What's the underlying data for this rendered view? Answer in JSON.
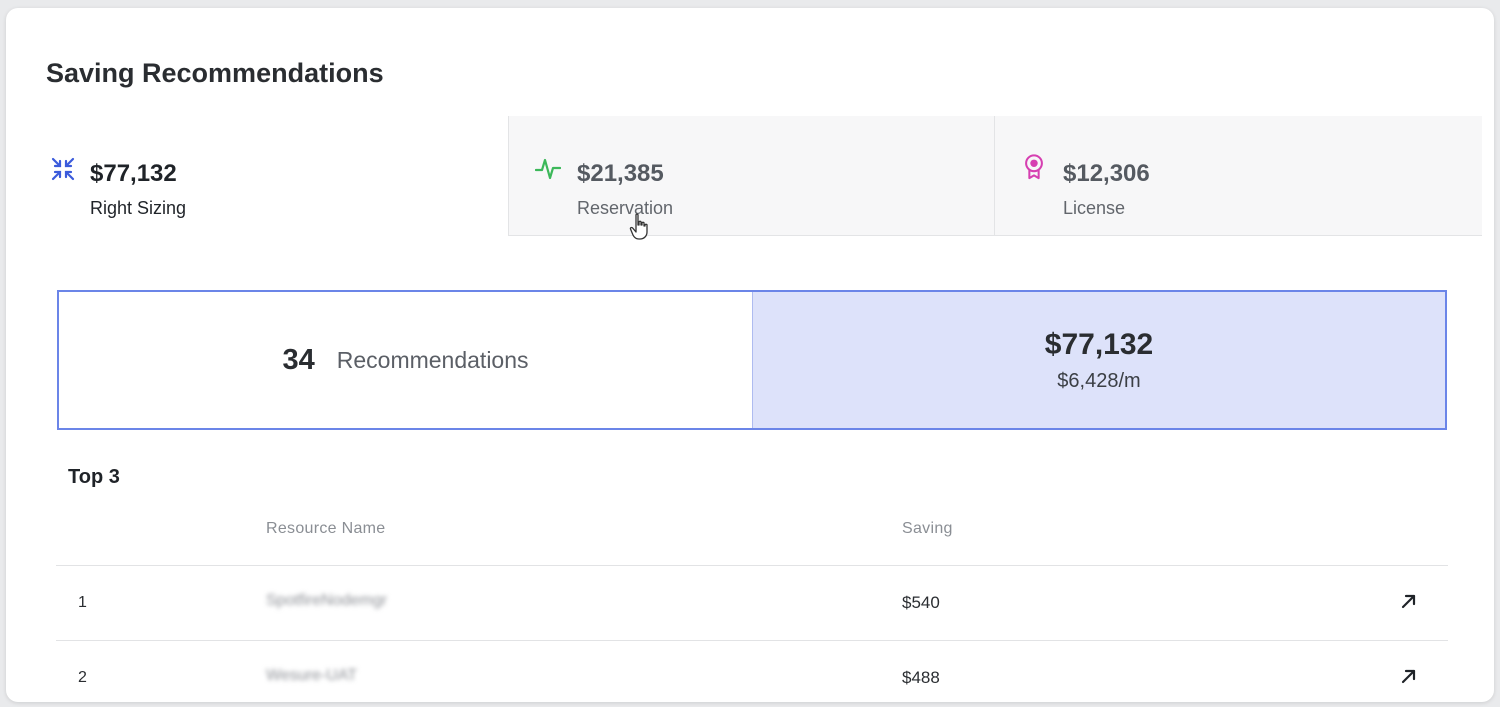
{
  "title": "Saving Recommendations",
  "tabs": [
    {
      "amount": "$77,132",
      "label": "Right Sizing",
      "icon": "compress-arrows-icon",
      "color": "#3b5bdb"
    },
    {
      "amount": "$21,385",
      "label": "Reservation",
      "icon": "activity-pulse-icon",
      "color": "#3cb85a"
    },
    {
      "amount": "$12,306",
      "label": "License",
      "icon": "award-badge-icon",
      "color": "#d63fb1"
    }
  ],
  "summary": {
    "count": "34",
    "count_label": "Recommendations",
    "total": "$77,132",
    "monthly": "$6,428/m"
  },
  "top": {
    "title": "Top 3",
    "headers": {
      "name": "Resource Name",
      "saving": "Saving"
    },
    "rows": [
      {
        "rank": "1",
        "name": "SpotfireNodemgr",
        "saving": "$540"
      },
      {
        "rank": "2",
        "name": "Wesure-UAT",
        "saving": "$488"
      }
    ]
  },
  "colors": {
    "accent_border": "#6b85e8",
    "accent_fill": "#dde2fa"
  }
}
